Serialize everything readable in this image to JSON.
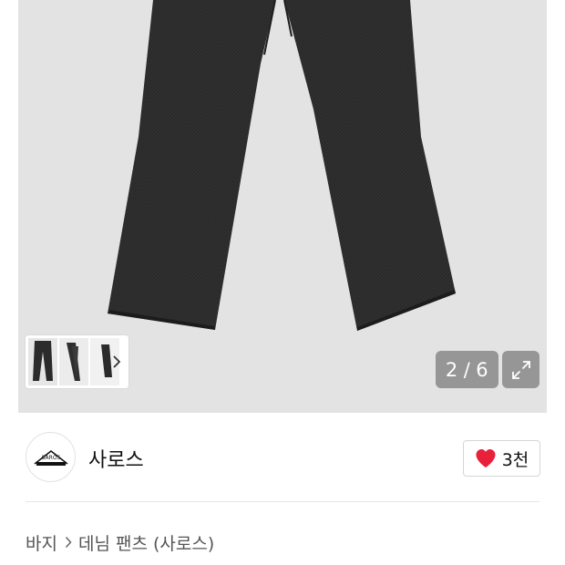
{
  "gallery": {
    "counter_current": "2",
    "counter_separator": "/",
    "counter_total": "6",
    "image_icon": "denim-pants-photo",
    "expand_icon": "expand-icon",
    "thumb_next_icon": "chevron-right-icon"
  },
  "brand": {
    "name": "사로스",
    "logo_text": "SAROS",
    "like_icon": "heart-icon",
    "like_color": "#e8203a",
    "like_count": "3천"
  },
  "breadcrumb": {
    "category": "바지",
    "separator_icon": "chevron-right-icon",
    "product": "데님 팬츠 (사로스)"
  }
}
